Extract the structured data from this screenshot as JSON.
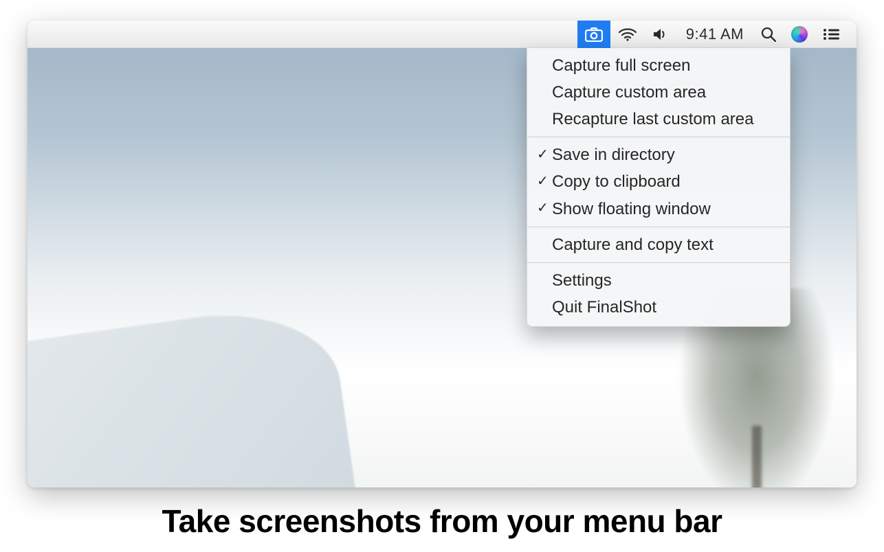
{
  "menubar": {
    "clock": "9:41 AM",
    "icons": {
      "app": "camera-icon",
      "wifi": "wifi-icon",
      "volume": "volume-icon",
      "search": "search-icon",
      "siri": "siri-icon",
      "list": "list-icon"
    }
  },
  "dropdown": {
    "sections": [
      [
        {
          "label": "Capture full screen",
          "checked": false
        },
        {
          "label": "Capture custom area",
          "checked": false
        },
        {
          "label": "Recapture last custom area",
          "checked": false
        }
      ],
      [
        {
          "label": "Save in directory",
          "checked": true
        },
        {
          "label": "Copy to clipboard",
          "checked": true
        },
        {
          "label": "Show floating window",
          "checked": true
        }
      ],
      [
        {
          "label": "Capture and copy text",
          "checked": false
        }
      ],
      [
        {
          "label": "Settings",
          "checked": false
        },
        {
          "label": "Quit FinalShot",
          "checked": false
        }
      ]
    ]
  },
  "caption": "Take screenshots from your menu bar"
}
